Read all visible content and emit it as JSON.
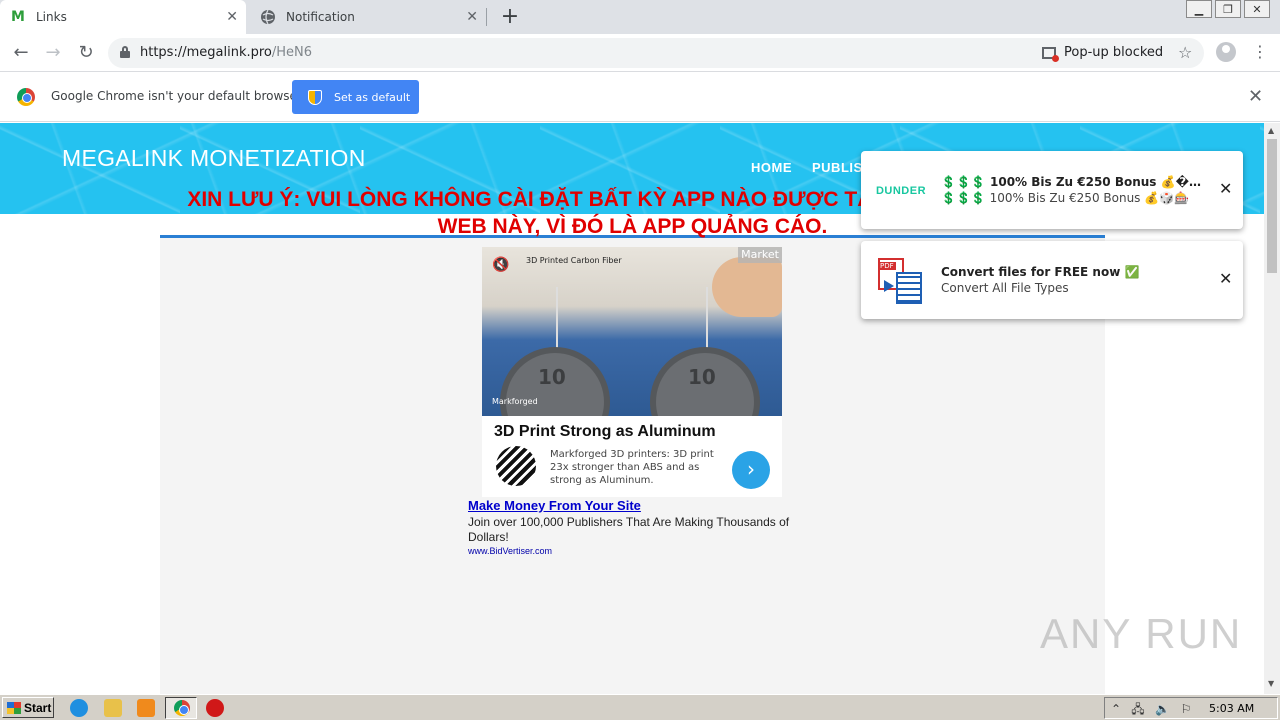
{
  "browser": {
    "tabs": [
      {
        "label": "Links",
        "icon": "M",
        "active": true
      },
      {
        "label": "Notification",
        "icon": "globe-icon",
        "active": false
      }
    ],
    "url_host": "https://megalink.pro",
    "url_path": "/HeN6",
    "popup_blocked": "Pop-up blocked"
  },
  "infobar": {
    "message": "Google Chrome isn't your default browser",
    "button": "Set as default"
  },
  "site": {
    "title": "MEGALINK MONETIZATION",
    "nav": [
      "HOME",
      "PUBLIS"
    ]
  },
  "page": {
    "warning": "XIN LƯU Ý: VUI LÒNG KHÔNG CÀI ĐẶT BẤT KỲ APP NÀO ĐƯỢC TẢI XUỐNG TỪ TRANG WEB NÀY, VÌ ĐÓ LÀ APP QUẢNG CÁO."
  },
  "ad": {
    "tag": "Market",
    "caption": "3D Printed Carbon Fiber",
    "brand": "Markforged",
    "headline": "3D Print Strong as Aluminum",
    "body": "Markforged 3D printers: 3D print 23x stronger than ABS and as strong as Aluminum."
  },
  "bidvertiser": {
    "link": "Make Money From Your Site",
    "desc": "Join over 100,000 Publishers That Are Making Thousands of Dollars!",
    "url": "www.BidVertiser.com"
  },
  "notifications": [
    {
      "brand": "DUNDER",
      "title": "💲💲💲 100% Bis Zu €250 Bonus 💰�...",
      "body": "💲💲💲 100% Bis Zu €250 Bonus 💰🎲🎰"
    },
    {
      "title": "Convert files for FREE now ✅",
      "body": "Convert All File Types"
    }
  ],
  "watermark": "ANY RUN",
  "taskbar": {
    "start": "Start",
    "clock": "5:03 AM"
  }
}
